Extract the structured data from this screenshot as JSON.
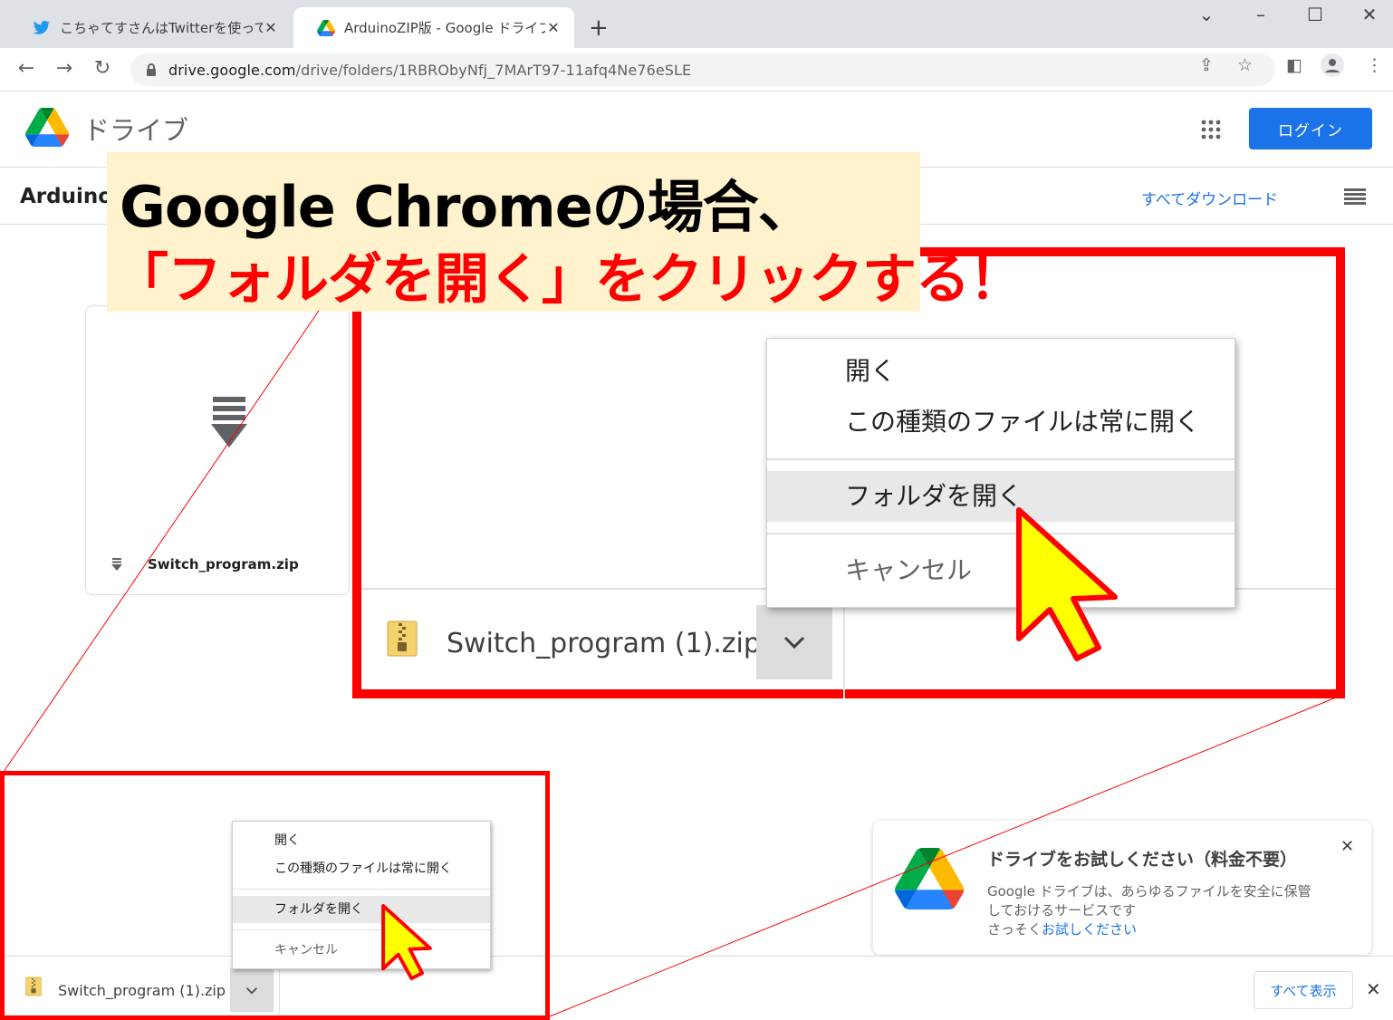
{
  "browser": {
    "tabs": [
      {
        "title": "こちゃてすさんはTwitterを使っています",
        "icon": "twitter-bird-icon",
        "active": false
      },
      {
        "title": "ArduinoZIP版 - Google ドライブ",
        "icon": "google-drive-icon",
        "active": true
      }
    ],
    "new_tab_label": "+",
    "url_host": "drive.google.com",
    "url_path": "/drive/folders/1RBRObyNfj_7MArT97-11afq4Ne76eSLE"
  },
  "drive": {
    "product_name": "ドライブ",
    "login_label": "ログイン",
    "folder_title": "ArduinoZ",
    "download_all_label": "すべてダウンロード",
    "file_card_name": "Switch_program.zip"
  },
  "callout": {
    "line1": "Google Chromeの場合、",
    "line2": "「フォルダを開く」をクリックする！",
    "line2_color": "#ff0000",
    "bg_color": "#fff2cc"
  },
  "context_menu": {
    "items": [
      "開く",
      "この種類のファイルは常に開く",
      "フォルダを開く",
      "キャンセル"
    ],
    "highlighted": "フォルダを開く"
  },
  "download_bar": {
    "file_name": "Switch_program (1).zip",
    "show_all_label": "すべて表示"
  },
  "promo": {
    "title": "ドライブをお試しください（料金不要）",
    "body_line1": "Google ドライブは、あらゆるファイルを安全に保管",
    "body_line2": "しておけるサービスです",
    "body_line3_prefix": "さっそく",
    "body_link": "お試しください"
  },
  "colors": {
    "accent": "#1a73e8",
    "highlight_border": "#ff0000",
    "pointer_fill": "#ffff00"
  }
}
